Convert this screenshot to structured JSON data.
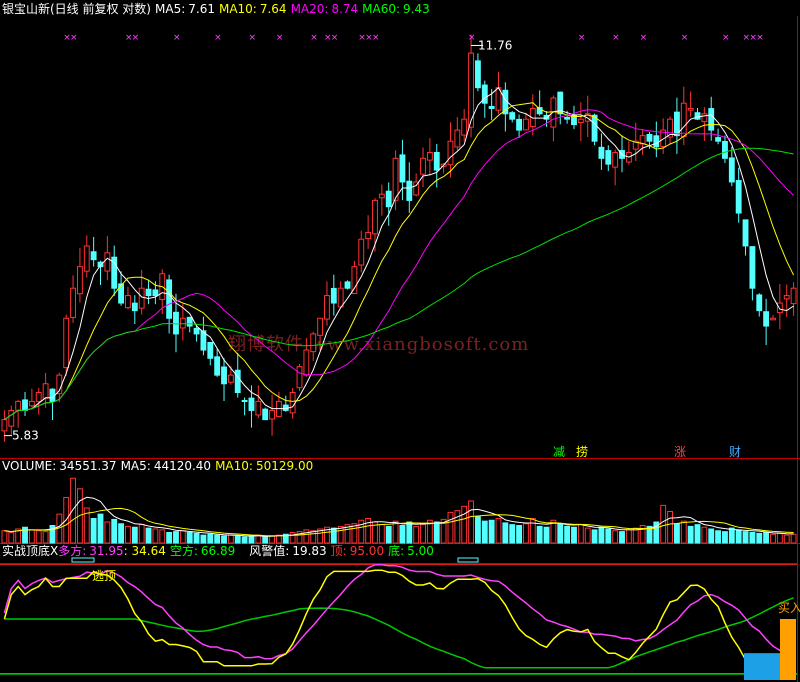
{
  "main_header": {
    "title": "银宝山新(日线 前复权 对数)",
    "ma5_label": "MA5:",
    "ma5_value": "7.61",
    "ma10_label": "MA10:",
    "ma10_value": "7.64",
    "ma20_label": "MA20:",
    "ma20_value": "8.74",
    "ma60_label": "MA60:",
    "ma60_value": "9.43"
  },
  "volume_header": {
    "label": "VOLUME:",
    "value": "34551.37",
    "ma5_label": "MA5:",
    "ma5_value": "44120.40",
    "ma10_label": "MA10:",
    "ma10_value": "50129.00"
  },
  "indicator_header": {
    "name": "实战顶底X",
    "long_label": "多方:",
    "long_value": "31.95",
    "mid_value": ": 34.64",
    "short_label": "空方:",
    "short_value": "66.89",
    "warn_label": "风警值:",
    "warn_value": "19.83",
    "top_label": "顶:",
    "top_value": "95.00",
    "bottom_label": "底:",
    "bottom_value": "5.00"
  },
  "annotations": {
    "high_price": "11.76",
    "low_price": "5.83",
    "flag_reduce": "减",
    "flag_hold": "捞",
    "flag_rise": "涨",
    "flag_wealth": "财",
    "escape_top": "逃顶",
    "buy_in": "买入"
  },
  "watermark": "翔博软件 www.xiangbosoft.com",
  "colors": {
    "up": "#ff3232",
    "down": "#54ffff",
    "ma5": "#ffffff",
    "ma10": "#ffff00",
    "ma20": "#ff00ff",
    "ma60": "#00e000",
    "signal_x": "#ff44ff",
    "border": "#c00000"
  },
  "chart_data": [
    {
      "type": "candlestick",
      "title": "银宝山新(日线 前复权 对数)",
      "scale": "log",
      "ylim": [
        5.6,
        12.4
      ],
      "high": 11.76,
      "low": 5.83,
      "series": [
        {
          "name": "MA5",
          "last": 7.61
        },
        {
          "name": "MA10",
          "last": 7.64
        },
        {
          "name": "MA20",
          "last": 8.74
        },
        {
          "name": "MA60",
          "last": 9.43
        }
      ],
      "close": [
        6.0,
        6.1,
        6.2,
        6.1,
        6.2,
        6.3,
        6.4,
        6.2,
        6.5,
        7.2,
        7.6,
        7.9,
        8.2,
        8.0,
        7.9,
        8.1,
        7.6,
        7.4,
        7.5,
        7.3,
        7.6,
        7.5,
        7.5,
        7.8,
        7.2,
        7.0,
        7.2,
        7.1,
        7.0,
        6.8,
        6.7,
        6.5,
        6.4,
        6.5,
        6.3,
        6.2,
        6.1,
        6.2,
        6.0,
        6.1,
        6.2,
        6.1,
        6.3,
        6.6,
        6.8,
        7.0,
        7.2,
        7.5,
        7.4,
        7.6,
        7.6,
        7.9,
        8.3,
        8.4,
        8.9,
        9.0,
        8.8,
        9.6,
        9.2,
        8.9,
        9.2,
        9.6,
        9.7,
        9.4,
        9.5,
        9.9,
        10.1,
        10.3,
        11.6,
        10.9,
        10.6,
        10.5,
        10.9,
        10.4,
        10.3,
        10.1,
        10.3,
        10.5,
        10.4,
        10.3,
        10.7,
        10.4,
        10.3,
        10.2,
        10.3,
        10.4,
        9.9,
        9.6,
        9.5,
        9.7,
        9.6,
        9.7,
        9.9,
        10.0,
        9.9,
        9.8,
        10.1,
        10.3,
        10.0,
        10.6,
        10.5,
        10.3,
        10.4,
        10.1,
        9.9,
        9.6,
        9.2,
        8.7,
        8.2,
        7.6,
        7.3,
        7.1,
        7.2,
        7.4,
        7.5,
        7.6
      ],
      "volume_series": [
        {
          "name": "VOLUME",
          "last": 34551.37
        },
        {
          "name": "MA5",
          "last": 44120.4
        },
        {
          "name": "MA10",
          "last": 50129.0
        }
      ],
      "volume": [
        14,
        12,
        16,
        18,
        15,
        14,
        13,
        20,
        33,
        52,
        74,
        62,
        40,
        28,
        33,
        24,
        27,
        22,
        19,
        18,
        21,
        17,
        16,
        15,
        12,
        13,
        14,
        12,
        11,
        9,
        10,
        9,
        8,
        9,
        8,
        7,
        8,
        9,
        7,
        8,
        9,
        10,
        12,
        13,
        15,
        14,
        16,
        18,
        17,
        19,
        21,
        22,
        26,
        28,
        24,
        21,
        19,
        25,
        20,
        24,
        19,
        21,
        26,
        24,
        27,
        35,
        37,
        42,
        48,
        30,
        25,
        26,
        28,
        23,
        21,
        20,
        22,
        28,
        19,
        18,
        26,
        22,
        19,
        18,
        21,
        17,
        15,
        18,
        16,
        14,
        13,
        15,
        17,
        20,
        19,
        24,
        43,
        36,
        22,
        25,
        19,
        21,
        18,
        16,
        14,
        13,
        17,
        15,
        13,
        12,
        11,
        12,
        10,
        11,
        9,
        10
      ]
    },
    {
      "type": "line",
      "title": "实战顶底X",
      "ylim": [
        0,
        100
      ],
      "reference_lines": {
        "top": 95.0,
        "bottom": 5.0
      },
      "series": [
        {
          "name": "多方",
          "last": 31.95
        },
        {
          "name": "空方",
          "last": 66.89
        },
        {
          "name": "风警值",
          "last": 19.83
        }
      ]
    }
  ]
}
